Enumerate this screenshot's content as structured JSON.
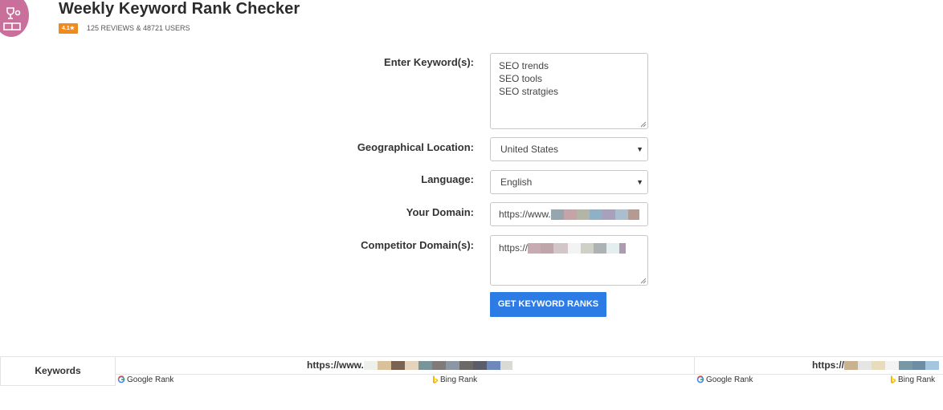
{
  "header": {
    "title": "Weekly Keyword Rank Checker",
    "rating": "4.1",
    "rating_star": "★",
    "reviews": "125 REVIEWS & 48721 USERS"
  },
  "form": {
    "keywords": {
      "label": "Enter Keyword(s):",
      "lines": [
        "SEO trends",
        "SEO tools",
        "SEO stratgies"
      ]
    },
    "location": {
      "label": "Geographical Location:",
      "value": "United States"
    },
    "language": {
      "label": "Language:",
      "value": "English"
    },
    "domain": {
      "label": "Your Domain:",
      "prefix": "https://www."
    },
    "competitor": {
      "label": "Competitor Domain(s):",
      "prefix": "https://"
    },
    "submit_label": "GET KEYWORD RANKS"
  },
  "results": {
    "keywords_header": "Keywords",
    "domain1_prefix": "https://www.",
    "domain2_prefix": "https://",
    "google_rank": "Google Rank",
    "bing_rank": "Bing Rank"
  },
  "colors": {
    "accent": "#2d7be5",
    "badge": "#f08a1c",
    "logo": "#c8709b"
  },
  "icons": [
    "trophy-icon",
    "chevron-down-icon",
    "google-icon",
    "bing-icon"
  ]
}
